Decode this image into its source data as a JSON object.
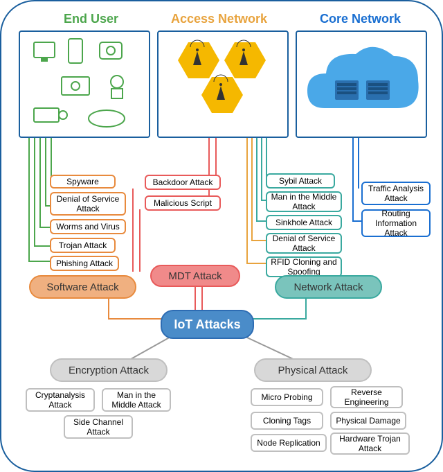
{
  "titles": {
    "end_user": "End User",
    "access_network": "Access Network",
    "core_network": "Core Network"
  },
  "central": "IoT Attacks",
  "categories": {
    "software": "Software Attack",
    "mdt": "MDT Attack",
    "network": "Network Attack",
    "encryption": "Encryption Attack",
    "physical": "Physical Attack"
  },
  "software_list": [
    "Spyware",
    "Denial of Service Attack",
    "Worms and Virus",
    "Trojan Attack",
    "Phishing Attack"
  ],
  "mdt_list": [
    "Backdoor Attack",
    "Malicious Script"
  ],
  "network_list": [
    "Sybil Attack",
    "Man in the Middle Attack",
    "Sinkhole Attack",
    "Denial of Service Attack",
    "RFID Cloning and Spoofing"
  ],
  "core_list": [
    "Traffic Analysis Attack",
    "Routing Information Attack"
  ],
  "encryption_list": [
    "Cryptanalysis Attack",
    "Man in the Middle Attack",
    "Side Channel Attack"
  ],
  "physical_list": [
    "Micro Probing",
    "Reverse Engineering",
    "Cloning Tags",
    "Physical Damage",
    "Node Replication",
    "Hardware Trojan Attack"
  ],
  "colors": {
    "end_user": "#4ca64c",
    "access": "#e8a33d",
    "core": "#1a6fd1",
    "software": "#e88a3d",
    "mdt": "#e85a5a",
    "network": "#3aa99f",
    "encryption": "#bfbfbf",
    "physical": "#bfbfbf",
    "central": "#2d6cb3"
  }
}
